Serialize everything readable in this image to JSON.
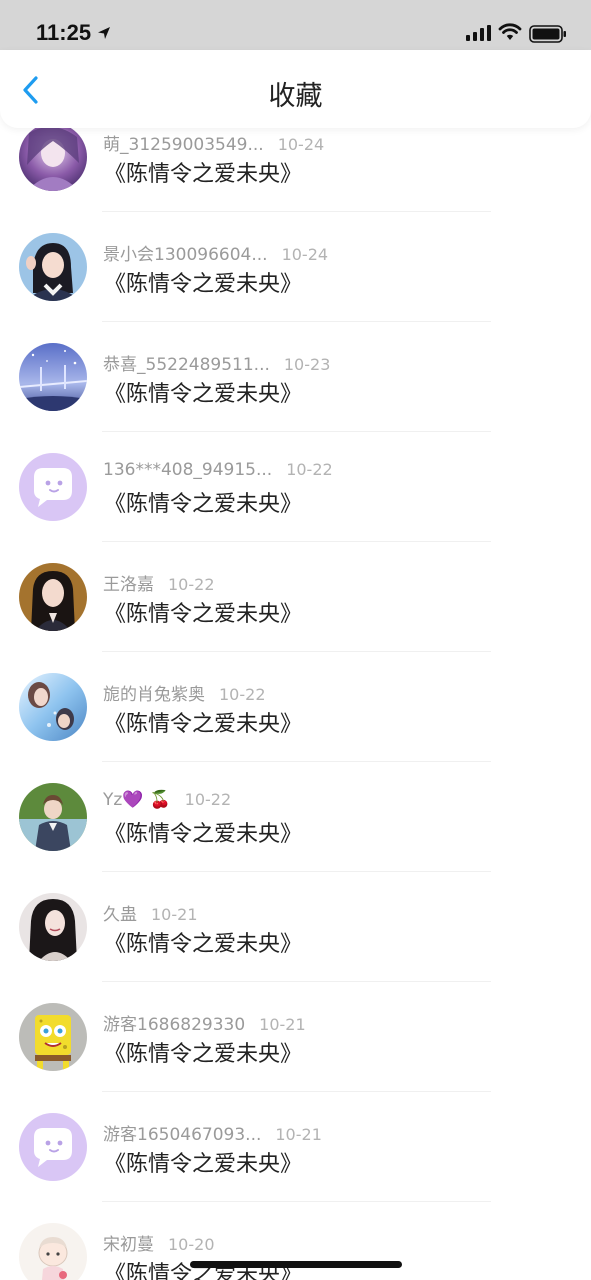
{
  "status": {
    "time": "11:25"
  },
  "nav": {
    "title": "收藏"
  },
  "items": [
    {
      "user": "萌_31259003549...",
      "date": "10-24",
      "title": "《陈情令之爱未央》",
      "avatar": "purple-fantasy"
    },
    {
      "user": "景小会130096604...",
      "date": "10-24",
      "title": "《陈情令之爱未央》",
      "avatar": "girl-peace"
    },
    {
      "user": "恭喜_5522489511...",
      "date": "10-23",
      "title": "《陈情令之爱未央》",
      "avatar": "night-bridge"
    },
    {
      "user": "136***408_94915...",
      "date": "10-22",
      "title": "《陈情令之爱未央》",
      "avatar": "default-chat"
    },
    {
      "user": "王洛嘉",
      "date": "10-22",
      "title": "《陈情令之爱未央》",
      "avatar": "girl-portrait"
    },
    {
      "user": "旎的肖兔紫奥",
      "date": "10-22",
      "title": "《陈情令之爱未央》",
      "avatar": "blue-couple"
    },
    {
      "user": "Yz",
      "emoji1": "💜",
      "emoji2": "🍒",
      "date": "10-22",
      "title": "《陈情令之爱未央》",
      "avatar": "boy-outdoor"
    },
    {
      "user": "久蛊",
      "date": "10-21",
      "title": "《陈情令之爱未央》",
      "avatar": "dark-hair-girl"
    },
    {
      "user": "游客1686829330",
      "date": "10-21",
      "title": "《陈情令之爱未央》",
      "avatar": "spongebob"
    },
    {
      "user": "游客1650467093...",
      "date": "10-21",
      "title": "《陈情令之爱未央》",
      "avatar": "default-chat"
    },
    {
      "user": "宋初蔓",
      "date": "10-20",
      "title": "《陈情令之爱未央》",
      "avatar": "chibi-drawing"
    }
  ],
  "colors": {
    "accent": "#1e9cf0",
    "status_bar": "#d6d6d6",
    "default_avatar": "#d9c6f5"
  }
}
